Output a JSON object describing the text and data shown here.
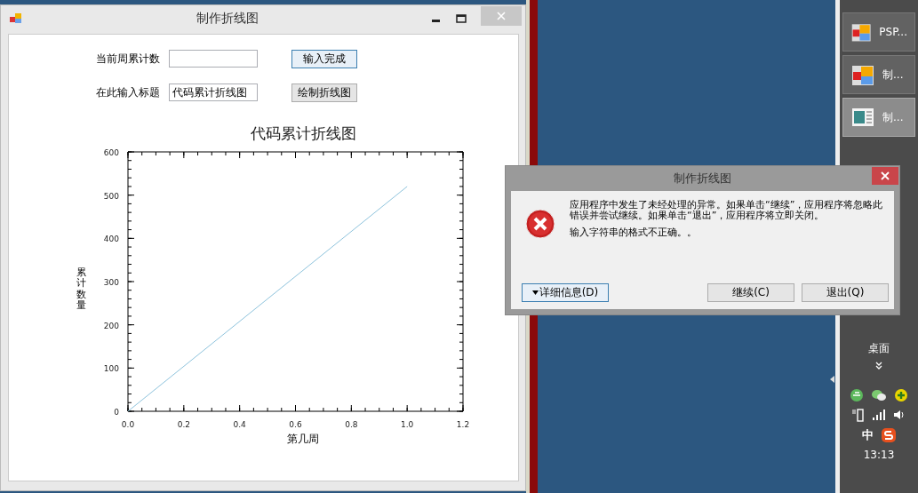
{
  "main_window": {
    "title": "制作折线图"
  },
  "form": {
    "rows": [
      {
        "label": "当前周累计数",
        "value": "",
        "button": "输入完成",
        "focused": true
      },
      {
        "label": "在此输入标题",
        "value": "代码累计折线图",
        "button": "绘制折线图",
        "focused": false
      }
    ]
  },
  "chart": {
    "chart_data": {
      "type": "line",
      "title": "代码累计折线图",
      "xlabel": "第几周",
      "ylabel": "累计数量",
      "x": [
        0,
        1.0
      ],
      "series": [
        {
          "color": "#8ec3dc",
          "values": [
            0,
            520
          ]
        }
      ],
      "xlim": [
        0,
        1.2
      ],
      "ylim": [
        0,
        600
      ],
      "xticks": [
        {
          "value": 0,
          "label": "0.0"
        },
        {
          "value": 0.2,
          "label": "0.2"
        },
        {
          "value": 0.4,
          "label": "0.4"
        },
        {
          "value": 0.6,
          "label": "0.6"
        },
        {
          "value": 0.8,
          "label": "0.8"
        },
        {
          "value": 1.0,
          "label": "1.0"
        },
        {
          "value": 1.2,
          "label": "1.2"
        }
      ],
      "yticks": [
        0,
        100,
        200,
        300,
        400,
        500,
        600
      ]
    }
  },
  "dialog": {
    "title": "制作折线图",
    "message": "应用程序中发生了未经处理的异常。如果单击“继续”，应用程序将忽略此错误并尝试继续。如果单击“退出”，应用程序将立即关闭。",
    "detail": "输入字符串的格式不正确。。",
    "buttons": [
      {
        "kind": "details",
        "label": "详细信息(D)",
        "focused": true
      },
      {
        "kind": "plain",
        "label": "继续(C)",
        "focused": false
      },
      {
        "kind": "plain",
        "label": "退出(Q)",
        "focused": false
      }
    ]
  },
  "taskbar": {
    "items": [
      {
        "kind": "app",
        "label": "PSP...",
        "selected": false
      },
      {
        "kind": "app",
        "label": "制...",
        "selected": false
      },
      {
        "kind": "doc",
        "label": "制...",
        "selected": true
      }
    ],
    "desktop": "桌面",
    "ime": "中",
    "time": "13:13"
  }
}
